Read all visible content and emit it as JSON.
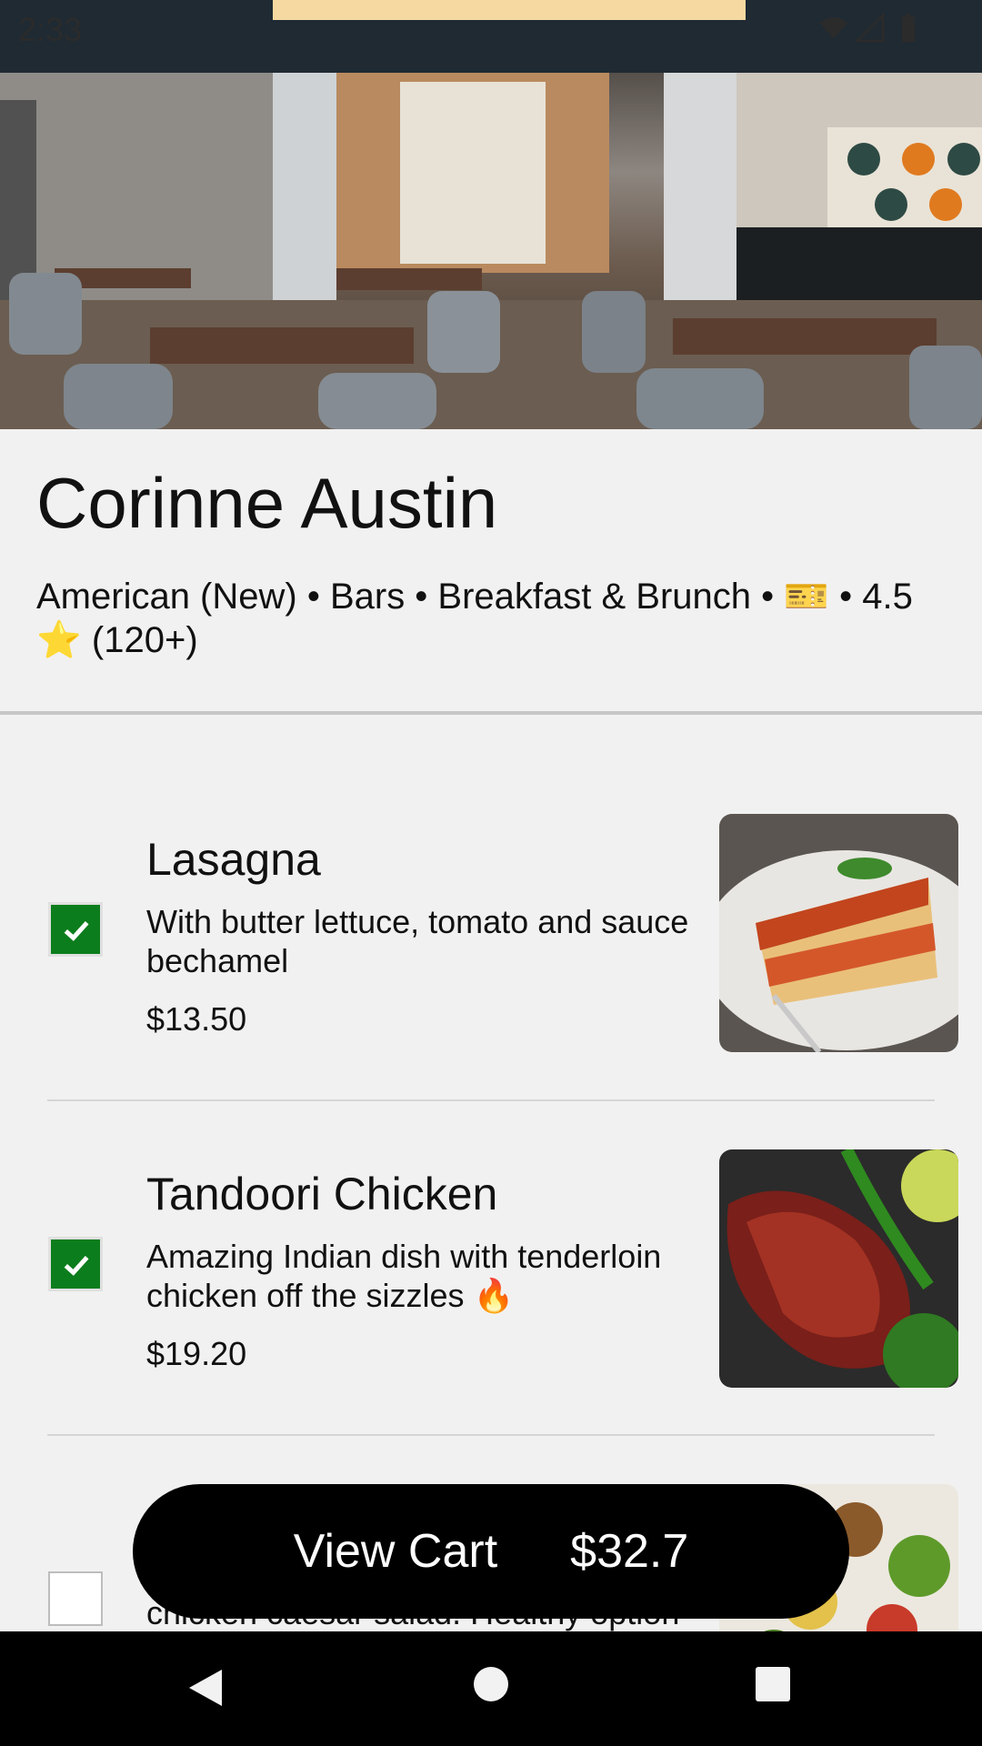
{
  "status_bar": {
    "time": "2:33"
  },
  "restaurant": {
    "name": "Corinne Austin",
    "meta": "American (New) • Bars • Breakfast & Brunch  • 🎫 • 4.5 ⭐ (120+)"
  },
  "items": [
    {
      "name": "Lasagna",
      "description": "With butter lettuce, tomato and sauce bechamel",
      "price": "$13.50",
      "checked": true
    },
    {
      "name": "Tandoori Chicken",
      "description": "Amazing Indian dish with tenderloin chicken off the sizzles 🔥",
      "price": "$19.20",
      "checked": true
    },
    {
      "name": "",
      "description": "chicken caesar salad. Healthy option",
      "price": "",
      "checked": false
    }
  ],
  "cart": {
    "label": "View Cart",
    "total": "$32.7"
  },
  "colors": {
    "accent_green": "#0c7d1d",
    "cart_bg": "#000000",
    "background": "#f2f1f1"
  },
  "icons": [
    "wifi-icon",
    "signal-icon",
    "battery-icon",
    "check-icon",
    "back-icon",
    "home-icon",
    "recents-icon"
  ]
}
